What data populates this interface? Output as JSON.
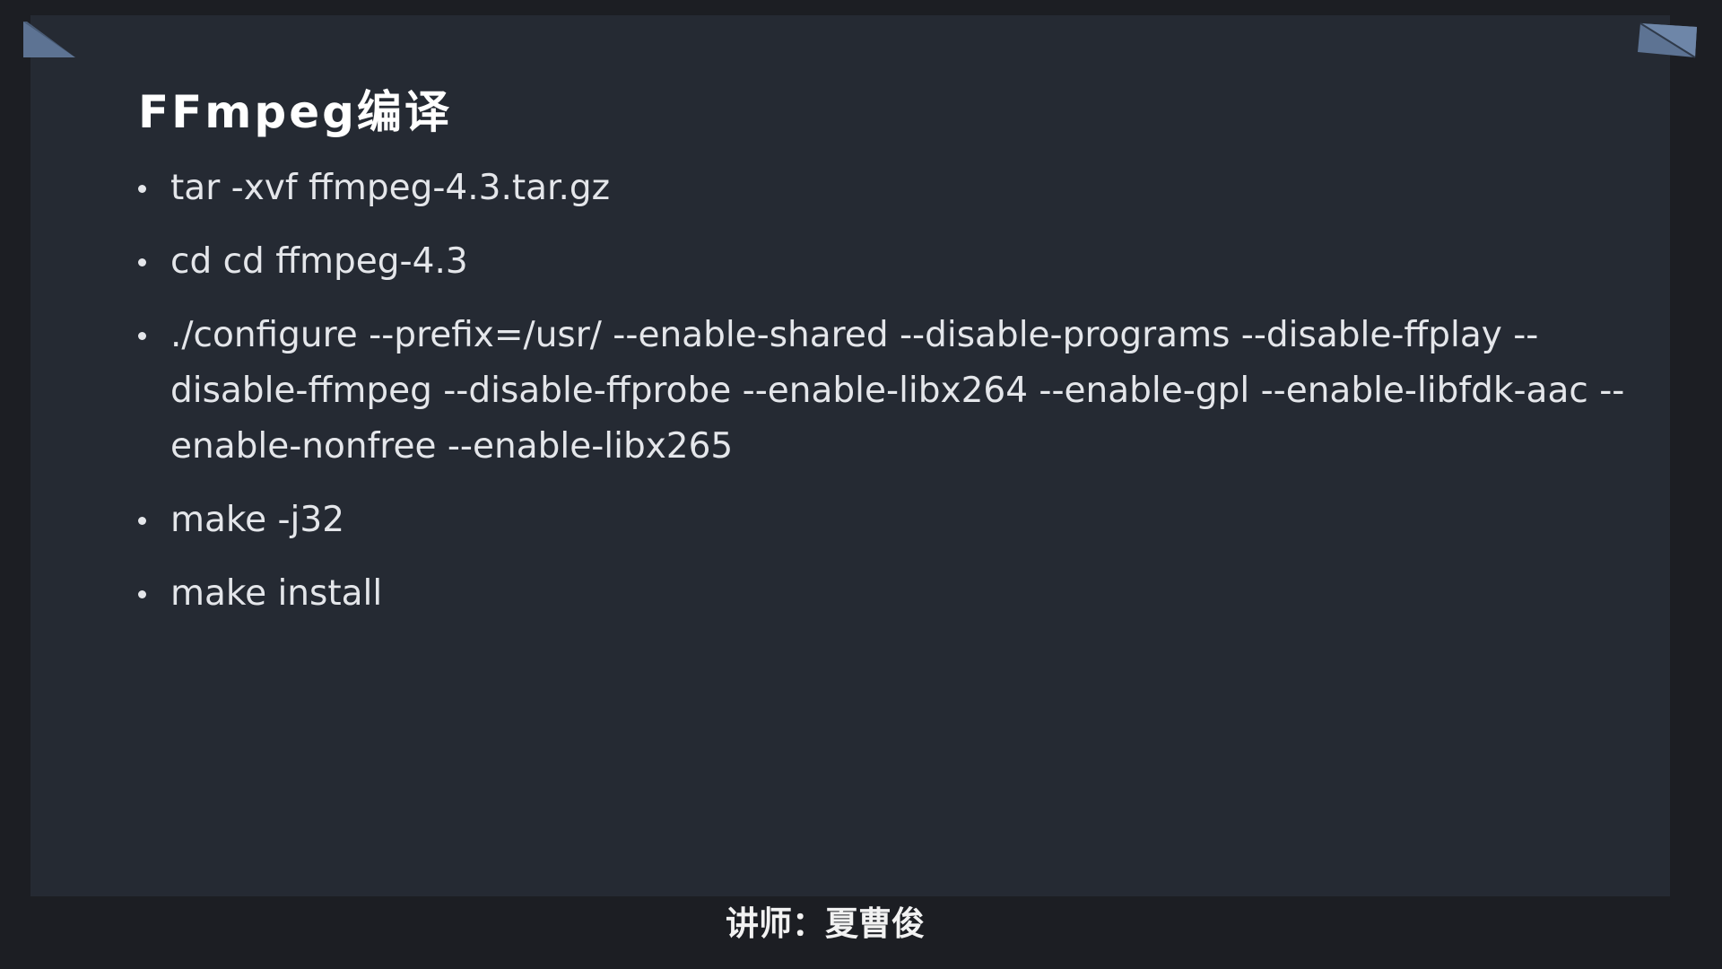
{
  "slide": {
    "title": "FFmpeg编译",
    "bullets": [
      {
        "text": "tar -xvf ffmpeg-4.3.tar.gz"
      },
      {
        "text": "cd cd ffmpeg-4.3"
      },
      {
        "text": "./configure --prefix=/usr/   --enable-shared --disable-programs --disable-ffplay  --disable-ffmpeg --disable-ffprobe  --enable-libx264 --enable-gpl --enable-libfdk-aac --enable-nonfree --enable-libx265"
      },
      {
        "text": "make -j32"
      },
      {
        "text": "make install"
      }
    ]
  },
  "footer": {
    "lecturer": "讲师：夏曹俊"
  },
  "colors": {
    "page_background": "#1c1e23",
    "slide_background": "#252a33",
    "corner_fold": "#5d7393",
    "text": "#e4e6ea"
  }
}
